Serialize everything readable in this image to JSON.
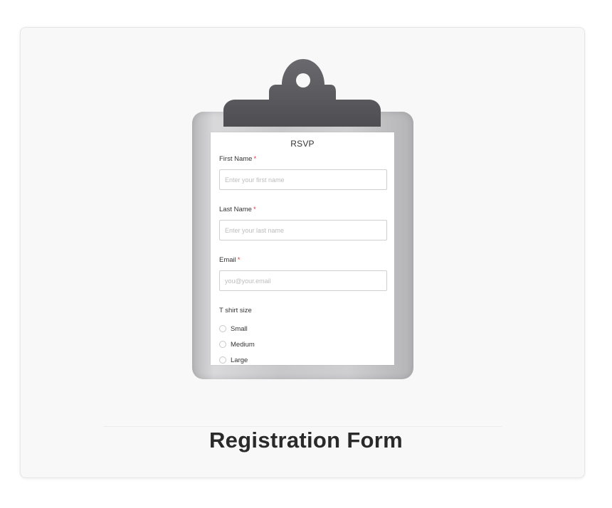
{
  "form": {
    "title": "RSVP",
    "fields": [
      {
        "label": "First Name",
        "required_mark": "*",
        "placeholder": "Enter your first name"
      },
      {
        "label": "Last Name",
        "required_mark": "*",
        "placeholder": "Enter your last name"
      },
      {
        "label": "Email",
        "required_mark": "*",
        "placeholder": "you@your.email"
      }
    ],
    "tshirt": {
      "label": "T shirt size",
      "options": [
        "Small",
        "Medium",
        "Large"
      ]
    }
  },
  "caption": "Registration Form",
  "colors": {
    "required": "#e0343c",
    "clip": "#5e5e62",
    "board": "#c8c8ca"
  }
}
